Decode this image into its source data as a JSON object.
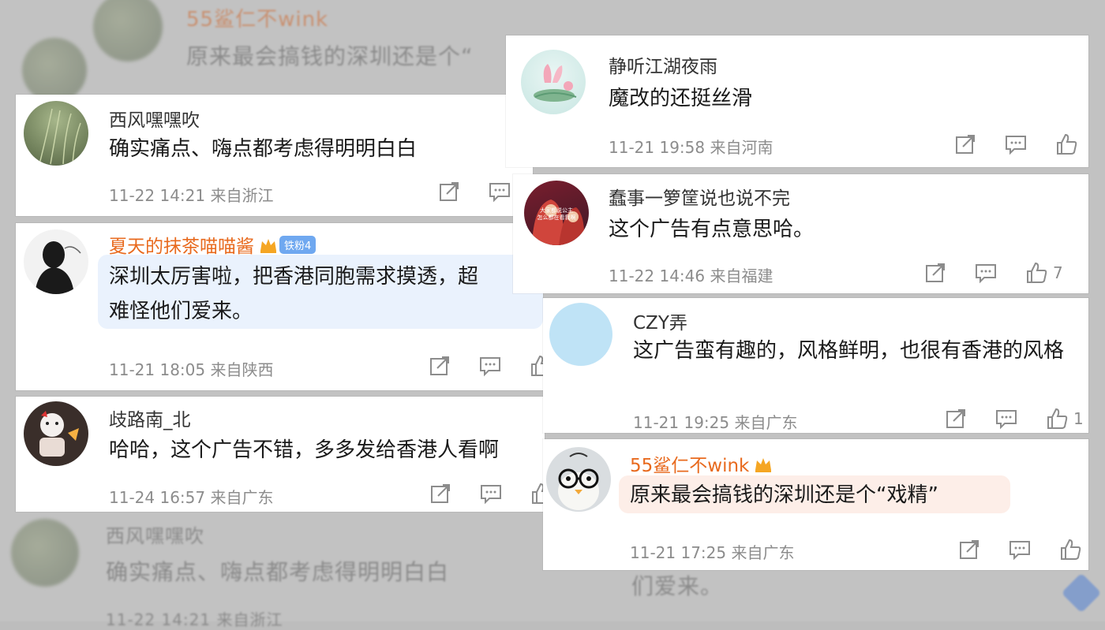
{
  "background": {
    "ghost_top_name": "55鲨仁不wink",
    "ghost_top_text": "原来最会搞钱的深圳还是个“",
    "ghost_bottom_name": "西风嘿嘿吹",
    "ghost_bottom_text": "确实痛点、嗨点都考虑得明明白白",
    "ghost_bottom_meta": "11-22 14:21 来自浙江",
    "ghost_right_text": "们爱来。"
  },
  "left_comments": [
    {
      "username": "西风嘿嘿吹",
      "content": "确实痛点、嗨点都考虑得明明白白",
      "time": "11-22 14:21",
      "location": "来自浙江",
      "likes": ""
    },
    {
      "username": "夏天的抹茶喵喵酱",
      "badge": "铁粉4",
      "content_line1": "深圳太厉害啦，把香港同胞需求摸透，超",
      "content_line2": "难怪他们爱来。",
      "time": "11-21 18:05",
      "location": "来自陕西",
      "likes": ""
    },
    {
      "username": "歧路南_北",
      "content": "哈哈，这个广告不错，多多发给香港人看啊",
      "time": "11-24 16:57",
      "location": "来自广东",
      "likes": ""
    }
  ],
  "right_comments": [
    {
      "username": "静听江湖夜雨",
      "content": "魔改的还挺丝滑",
      "time": "11-21 19:58",
      "location": "来自河南",
      "likes": ""
    },
    {
      "username": "蠢事一箩筐说也说不完",
      "content": "这个广告有点意思哈。",
      "time": "11-22 14:46",
      "location": "来自福建",
      "likes": "7",
      "avatar_text_line1": "大家都说公主",
      "avatar_text_line2": "怎么都在看我啊"
    },
    {
      "username": "CZY弄",
      "content": "这广告蛮有趣的，风格鲜明，也很有香港的风格",
      "time": "11-21 19:25",
      "location": "来自广东",
      "likes": "1"
    },
    {
      "username": "55鲨仁不wink",
      "content": "原来最会搞钱的深圳还是个“戏精”",
      "time": "11-21 17:25",
      "location": "来自广东",
      "likes": ""
    }
  ],
  "colors": {
    "vip_name": "#e86a1e",
    "badge_bg": "#6fa8f0",
    "meta_gray": "#8c8c8c"
  },
  "icons": [
    "share-icon",
    "comment-icon",
    "like-icon",
    "crown-icon"
  ]
}
